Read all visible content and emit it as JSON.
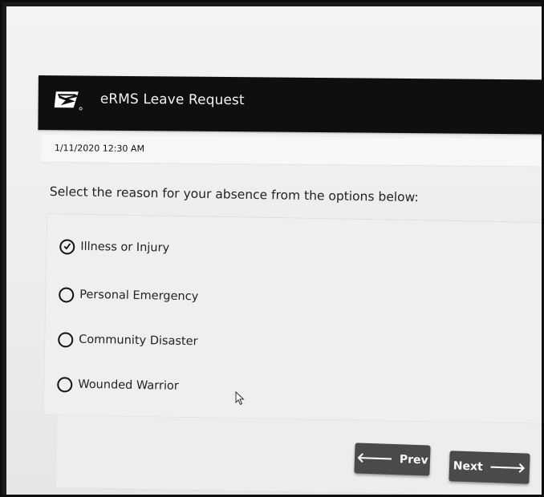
{
  "header": {
    "app_title": "eRMS Leave Request",
    "logo_icon": "eagle-logo-icon"
  },
  "meta": {
    "datetime": "1/11/2020 12:30 AM"
  },
  "form": {
    "question": "Select the reason for your absence from the options below:",
    "options": [
      {
        "label": "Illness or Injury",
        "selected": true
      },
      {
        "label": "Personal Emergency",
        "selected": false
      },
      {
        "label": "Community Disaster",
        "selected": false
      },
      {
        "label": "Wounded Warrior",
        "selected": false
      }
    ]
  },
  "navigation": {
    "prev_label": "Prev",
    "next_label": "Next",
    "prev_icon": "arrow-left-icon",
    "next_icon": "arrow-right-icon"
  },
  "colors": {
    "header_bg": "#0f0f0f",
    "button_bg": "#4a4a4a",
    "page_bg": "#efefef"
  }
}
